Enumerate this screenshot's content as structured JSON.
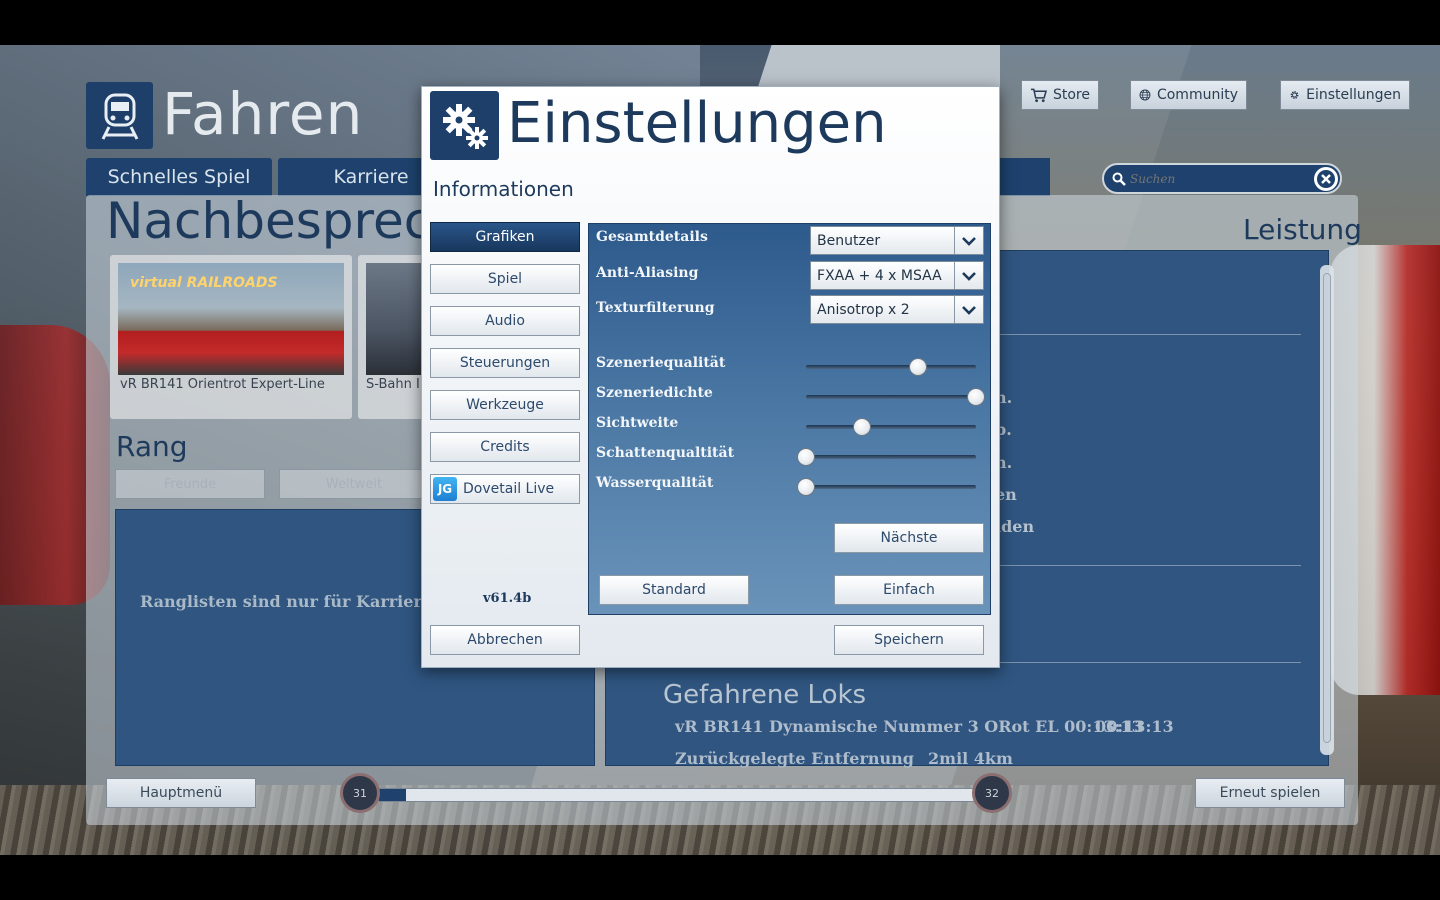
{
  "top_bar": {
    "store_label": "Store",
    "community_label": "Community",
    "settings_label": "Einstellungen"
  },
  "background": {
    "section_title": "Fahren",
    "tabs": [
      {
        "label": "Schnelles Spiel"
      },
      {
        "label": "Karriere"
      }
    ],
    "debrief_title": "Nachbesprech",
    "cards": [
      {
        "logo": "virtual RAILROADS",
        "label": "vR BR141 Orientrot Expert-Line"
      },
      {
        "label": "S-Bahn I"
      }
    ],
    "rank": {
      "title": "Rang",
      "friends_label": "Freunde",
      "world_label": "Weltweit",
      "message": "Ranglisten sind nur für Karriere Sz"
    },
    "search": {
      "placeholder": "Suchen"
    },
    "performance": {
      "title": "Leistung",
      "lines": [
        "n.",
        "p.",
        "n.",
        "en",
        "ıden"
      ]
    },
    "locos": {
      "title": "Gefahrene Loks",
      "item": "vR BR141 Dynamische Nummer 3 ORot EL 00:13:13",
      "time": "00:13:13",
      "distance_label": "Zurückgelegte Entfernung",
      "distance_value": "2mil 4km"
    },
    "bottom": {
      "main_menu_label": "Hauptmenü",
      "replay_label": "Erneut spielen",
      "level_current": "31",
      "level_next": "32",
      "level_progress": 0.045
    }
  },
  "dialog": {
    "title": "Einstellungen",
    "subtitle": "Informationen",
    "side_menu": [
      {
        "label": "Grafiken",
        "active": true
      },
      {
        "label": "Spiel",
        "active": false
      },
      {
        "label": "Audio",
        "active": false
      },
      {
        "label": "Steuerungen",
        "active": false
      },
      {
        "label": "Werkzeuge",
        "active": false
      },
      {
        "label": "Credits",
        "active": false
      },
      {
        "label": "Dovetail Live",
        "active": false,
        "icon": "dovetail-live-icon",
        "icon_text": "JG"
      }
    ],
    "version": "v61.4b",
    "graphics": {
      "selects": [
        {
          "label": "Gesamtdetails",
          "value": "Benutzer"
        },
        {
          "label": "Anti-Aliasing",
          "value": "FXAA + 4 x MSAA"
        },
        {
          "label": "Texturfilterung",
          "value": "Anisotrop x 2"
        }
      ],
      "sliders": [
        {
          "label": "Szeneriequalität",
          "value": 0.66
        },
        {
          "label": "Szeneriedichte",
          "value": 1.0
        },
        {
          "label": "Sichtweite",
          "value": 0.33
        },
        {
          "label": "Schattenqualtität",
          "value": 0.0
        },
        {
          "label": "Wasserqualität",
          "value": 0.0
        }
      ],
      "next_label": "Nächste",
      "standard_label": "Standard",
      "simple_label": "Einfach"
    },
    "cancel_label": "Abbrechen",
    "save_label": "Speichern"
  },
  "colors": {
    "brand_blue": "#1d3f6a",
    "panel_blue": "#2f5580",
    "active_tab": "#17365c"
  }
}
